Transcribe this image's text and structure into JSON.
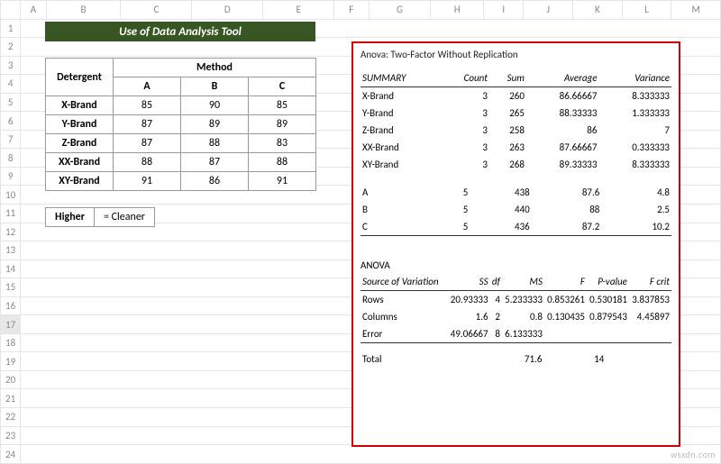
{
  "cols": [
    "A",
    "B",
    "C",
    "D",
    "E",
    "F",
    "G",
    "H",
    "I",
    "J",
    "K",
    "L",
    "M"
  ],
  "rows": [
    "1",
    "2",
    "3",
    "4",
    "5",
    "6",
    "7",
    "8",
    "9",
    "10",
    "11",
    "12",
    "13",
    "14",
    "15",
    "16",
    "17",
    "18",
    "19",
    "20",
    "21",
    "22",
    "23",
    "24"
  ],
  "selected_row": "17",
  "title": "Use of Data Analysis Tool",
  "table": {
    "corner": "Detergent",
    "method_hdr": "Method",
    "cols": [
      "A",
      "B",
      "C"
    ],
    "rows": [
      {
        "label": "X-Brand",
        "vals": [
          85,
          90,
          85
        ]
      },
      {
        "label": "Y-Brand",
        "vals": [
          87,
          89,
          89
        ]
      },
      {
        "label": "Z-Brand",
        "vals": [
          87,
          88,
          83
        ]
      },
      {
        "label": "XX-Brand",
        "vals": [
          88,
          87,
          88
        ]
      },
      {
        "label": "XY-Brand",
        "vals": [
          91,
          86,
          91
        ]
      }
    ]
  },
  "legend": {
    "a": "Higher",
    "b": "= Cleaner"
  },
  "anova": {
    "heading": "Anova: Two-Factor Without Replication",
    "summary_label": "SUMMARY",
    "summary_cols": [
      "Count",
      "Sum",
      "Average",
      "Variance"
    ],
    "summary_rows": [
      {
        "name": "X-Brand",
        "count": 3,
        "sum": 260,
        "avg": "86.66667",
        "var": "8.333333"
      },
      {
        "name": "Y-Brand",
        "count": 3,
        "sum": 265,
        "avg": "88.33333",
        "var": "1.333333"
      },
      {
        "name": "Z-Brand",
        "count": 3,
        "sum": 258,
        "avg": "86",
        "var": "7"
      },
      {
        "name": "XX-Brand",
        "count": 3,
        "sum": 263,
        "avg": "87.66667",
        "var": "0.333333"
      },
      {
        "name": "XY-Brand",
        "count": 3,
        "sum": 268,
        "avg": "89.33333",
        "var": "8.333333"
      }
    ],
    "abc_rows": [
      {
        "name": "A",
        "count": 5,
        "sum": 438,
        "avg": "87.6",
        "var": "4.8"
      },
      {
        "name": "B",
        "count": 5,
        "sum": 440,
        "avg": "88",
        "var": "2.5"
      },
      {
        "name": "C",
        "count": 5,
        "sum": 436,
        "avg": "87.2",
        "var": "10.2"
      }
    ],
    "anova_label": "ANOVA",
    "anova_cols": [
      "Source of Variation",
      "SS",
      "df",
      "MS",
      "F",
      "P-value",
      "F crit"
    ],
    "anova_rows": [
      {
        "src": "Rows",
        "ss": "20.93333",
        "df": 4,
        "ms": "5.233333",
        "f": "0.853261",
        "p": "0.530181",
        "fcrit": "3.837853"
      },
      {
        "src": "Columns",
        "ss": "1.6",
        "df": 2,
        "ms": "0.8",
        "f": "0.130435",
        "p": "0.879543",
        "fcrit": "4.45897"
      },
      {
        "src": "Error",
        "ss": "49.06667",
        "df": 8,
        "ms": "6.133333",
        "f": "",
        "p": "",
        "fcrit": ""
      }
    ],
    "total": {
      "label": "Total",
      "ss": "71.6",
      "df": 14
    }
  },
  "watermark": "wsxdn.com"
}
